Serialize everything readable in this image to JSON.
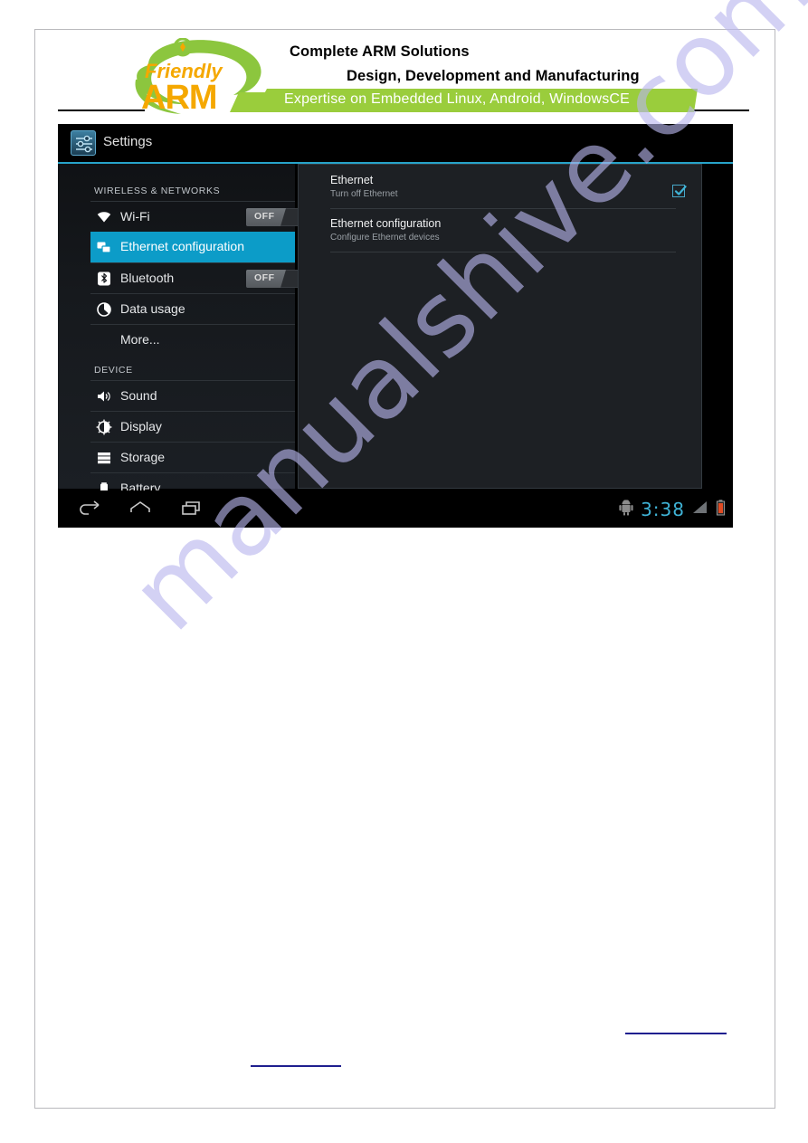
{
  "letterhead": {
    "brand_name_top": "Friendly",
    "brand_name_bottom": "ARM",
    "line1": "Complete ARM Solutions",
    "line2": "Design, Development and  Manufacturing",
    "banner": "Expertise on Embedded Linux, Android, WindowsCE",
    "banner_color": "#9acd3c",
    "brand_orange": "#f5a800",
    "brand_green": "#8cc63e"
  },
  "watermark": {
    "text": "manualshive.com",
    "color": "#b9b6ee"
  },
  "tablet": {
    "titlebar": {
      "title": "Settings",
      "icon": "settings-sliders-icon",
      "accent_color": "#27a3c9"
    },
    "sidebar": {
      "groups": [
        {
          "header": "WIRELESS & NETWORKS",
          "items": [
            {
              "label": "Wi-Fi",
              "icon": "wifi-icon",
              "toggle": "OFF",
              "selected": false
            },
            {
              "label": "Ethernet configuration",
              "icon": "ethernet-icon",
              "toggle": null,
              "selected": true
            },
            {
              "label": "Bluetooth",
              "icon": "bluetooth-icon",
              "toggle": "OFF",
              "selected": false
            },
            {
              "label": "Data usage",
              "icon": "data-usage-icon",
              "toggle": null,
              "selected": false
            },
            {
              "label": "More...",
              "icon": null,
              "toggle": null,
              "selected": false
            }
          ]
        },
        {
          "header": "DEVICE",
          "items": [
            {
              "label": "Sound",
              "icon": "sound-icon",
              "toggle": null,
              "selected": false
            },
            {
              "label": "Display",
              "icon": "display-icon",
              "toggle": null,
              "selected": false
            },
            {
              "label": "Storage",
              "icon": "storage-icon",
              "toggle": null,
              "selected": false
            },
            {
              "label": "Battery",
              "icon": "battery-icon",
              "toggle": null,
              "selected": false
            }
          ]
        }
      ],
      "selected_color": "#0c9cc8"
    },
    "content": {
      "rows": [
        {
          "title": "Ethernet",
          "subtitle": "Turn off Ethernet",
          "checkbox": "checked",
          "checkbox_color": "#47a8c9"
        },
        {
          "title": "Ethernet configuration",
          "subtitle": "Configure Ethernet devices",
          "checkbox": null,
          "checkbox_color": null
        }
      ]
    },
    "navbar": {
      "buttons": [
        {
          "name": "back",
          "icon": "back-arrow-icon"
        },
        {
          "name": "home",
          "icon": "home-icon"
        },
        {
          "name": "recents",
          "icon": "recent-apps-icon"
        }
      ],
      "status": {
        "usb_icon": "android-usb-debug-icon",
        "time": "3:38",
        "time_color": "#3fb3d6",
        "signal_icon": "signal-bars-icon",
        "battery_icon": "battery-low-icon",
        "battery_color": "#e04b23"
      }
    }
  }
}
